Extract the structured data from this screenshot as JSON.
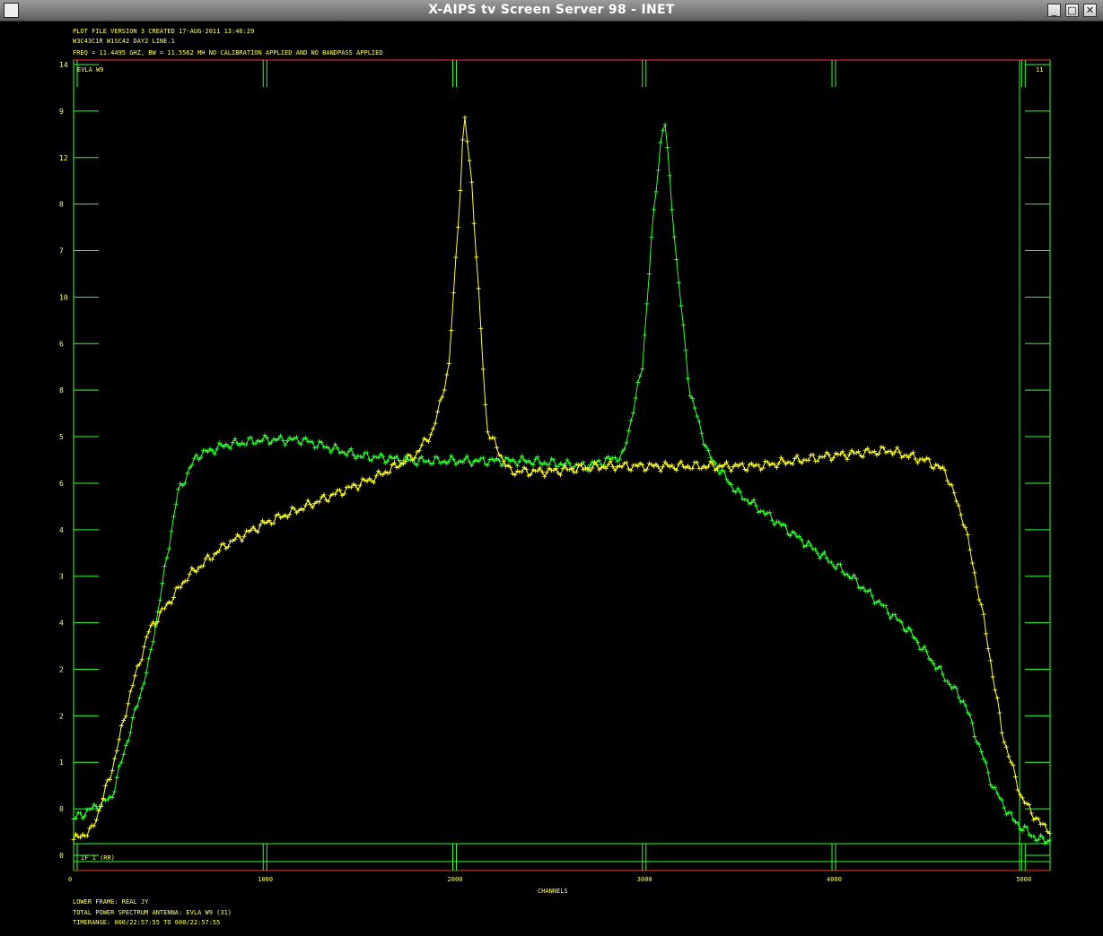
{
  "window": {
    "title": "X-AIPS tv Screen Server 98 - INET",
    "buttons": {
      "minimize": "_",
      "maximize": "□",
      "close": "✕"
    }
  },
  "header": {
    "line1": "PLOT FILE VERSION 3   CREATED 17-AUG-2011 13:46:29",
    "line2": "W3C43C1R    W1SC42 DAY2 LINE.1",
    "line3": "FREQ = 11.4495 GHZ, BW = 11.5562 MH    NO CALIBRATION APPLIED AND NO BANDPASS APPLIED"
  },
  "plot": {
    "station_label": "EVLA W9",
    "corner_label": "11",
    "bottom_label": "IF 1 (RR)",
    "x_axis_label": "CHANNELS"
  },
  "footer": {
    "line1": "LOWER FRAME: REAL JY",
    "line2": "TOTAL POWER SPECTRUM     ANTENNA: EVLA W9 (31)",
    "line3": "TIMERANGE: 000/22:57:55 TO 000/22:57:55"
  },
  "colors": {
    "green": "#33ff33",
    "yellow": "#ffff33",
    "red": "#ff3333",
    "axis": "#33ff33",
    "text": "#ffff66",
    "background": "#000000"
  },
  "chart_data": {
    "type": "line",
    "x_ticks": [
      "0",
      "1000",
      "2000",
      "3000",
      "4000",
      "5000"
    ],
    "xlim": [
      0,
      5150
    ],
    "left_ticks_upper": [
      "14",
      "9",
      "12",
      "8",
      "7",
      "10",
      "6",
      "8",
      "5",
      "6",
      "4",
      "3",
      "4",
      "2",
      "2",
      "1",
      "0",
      "0"
    ],
    "series": [
      {
        "name": "green",
        "x": [
          0,
          200,
          400,
          550,
          650,
          800,
          1000,
          1200,
          1500,
          1800,
          2100,
          2400,
          2700,
          2900,
          3000,
          3050,
          3100,
          3120,
          3180,
          3250,
          3350,
          3500,
          3800,
          4100,
          4400,
          4700,
          4850,
          4950,
          5050,
          5100,
          5150
        ],
        "y": [
          0.4,
          0.8,
          3.4,
          6.6,
          7.3,
          7.5,
          7.6,
          7.6,
          7.3,
          7.2,
          7.2,
          7.2,
          7.1,
          7.3,
          9.0,
          11.5,
          13.4,
          13.6,
          11.0,
          8.5,
          7.3,
          6.6,
          5.8,
          5.0,
          4.0,
          2.6,
          1.0,
          0.4,
          0.1,
          0.0,
          0.0
        ]
      },
      {
        "name": "yellow",
        "x": [
          0,
          100,
          200,
          300,
          400,
          600,
          800,
          1000,
          1200,
          1400,
          1600,
          1800,
          1900,
          1980,
          2040,
          2060,
          2100,
          2180,
          2300,
          2500,
          2800,
          3200,
          3600,
          4000,
          4300,
          4500,
          4600,
          4700,
          4800,
          4900,
          5000,
          5100,
          5150
        ],
        "y": [
          0.0,
          0.2,
          1.3,
          2.8,
          4.0,
          5.0,
          5.6,
          6.0,
          6.3,
          6.6,
          6.9,
          7.3,
          7.8,
          9.0,
          12.4,
          13.8,
          12.5,
          7.8,
          7.0,
          7.0,
          7.1,
          7.1,
          7.1,
          7.3,
          7.4,
          7.2,
          7.0,
          6.0,
          4.2,
          2.0,
          0.8,
          0.3,
          0.2
        ]
      }
    ]
  }
}
